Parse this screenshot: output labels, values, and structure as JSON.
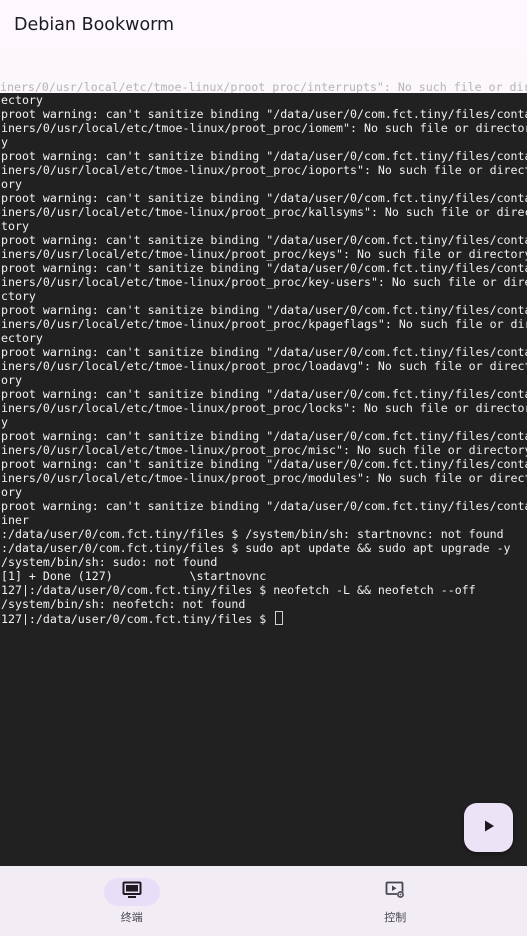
{
  "app_bar": {
    "title": "Debian Bookworm"
  },
  "terminal": {
    "faded_line": "iners/0/usr/local/etc/tmoe-linux/proot_proc/interrupts\": No such file or dir",
    "lines": [
      "ectory",
      "proot warning: can't sanitize binding \"/data/user/0/com.fct.tiny/files/conta",
      "iners/0/usr/local/etc/tmoe-linux/proot_proc/iomem\": No such file or director",
      "y",
      "proot warning: can't sanitize binding \"/data/user/0/com.fct.tiny/files/conta",
      "iners/0/usr/local/etc/tmoe-linux/proot_proc/ioports\": No such file or direct",
      "ory",
      "proot warning: can't sanitize binding \"/data/user/0/com.fct.tiny/files/conta",
      "iners/0/usr/local/etc/tmoe-linux/proot_proc/kallsyms\": No such file or direc",
      "tory",
      "proot warning: can't sanitize binding \"/data/user/0/com.fct.tiny/files/conta",
      "iners/0/usr/local/etc/tmoe-linux/proot_proc/keys\": No such file or directory",
      "proot warning: can't sanitize binding \"/data/user/0/com.fct.tiny/files/conta",
      "iners/0/usr/local/etc/tmoe-linux/proot_proc/key-users\": No such file or dire",
      "ctory",
      "proot warning: can't sanitize binding \"/data/user/0/com.fct.tiny/files/conta",
      "iners/0/usr/local/etc/tmoe-linux/proot_proc/kpageflags\": No such file or dir",
      "ectory",
      "proot warning: can't sanitize binding \"/data/user/0/com.fct.tiny/files/conta",
      "iners/0/usr/local/etc/tmoe-linux/proot_proc/loadavg\": No such file or direct",
      "ory",
      "proot warning: can't sanitize binding \"/data/user/0/com.fct.tiny/files/conta",
      "iners/0/usr/local/etc/tmoe-linux/proot_proc/locks\": No such file or director",
      "y",
      "proot warning: can't sanitize binding \"/data/user/0/com.fct.tiny/files/conta",
      "iners/0/usr/local/etc/tmoe-linux/proot_proc/misc\": No such file or directory",
      "proot warning: can't sanitize binding \"/data/user/0/com.fct.tiny/files/conta",
      "iners/0/usr/local/etc/tmoe-linux/proot_proc/modules\": No such file or direct",
      "ory",
      "proot warning: can't sanitize binding \"/data/user/0/com.fct.tiny/files/conta",
      "iner",
      ":/data/user/0/com.fct.tiny/files $ /system/bin/sh: startnovnc: not found",
      ":/data/user/0/com.fct.tiny/files $ sudo apt update && sudo apt upgrade -y",
      "/system/bin/sh: sudo: not found",
      "[1] + Done (127)           \\startnovnc",
      "127|:/data/user/0/com.fct.tiny/files $ neofetch -L && neofetch --off",
      "/system/bin/sh: neofetch: not found",
      "127|:/data/user/0/com.fct.tiny/files $ "
    ]
  },
  "fab": {
    "icon": "play-icon"
  },
  "bottom_nav": {
    "items": [
      {
        "label": "终端",
        "icon": "monitor-icon",
        "active": true
      },
      {
        "label": "控制",
        "icon": "video-settings-icon",
        "active": false
      }
    ]
  },
  "colors": {
    "terminal_bg": "#212121",
    "terminal_fg": "#f2f2f2",
    "surface": "#fdf8fd",
    "nav_bg": "#f2edf5",
    "active_indicator": "#e8def8"
  }
}
